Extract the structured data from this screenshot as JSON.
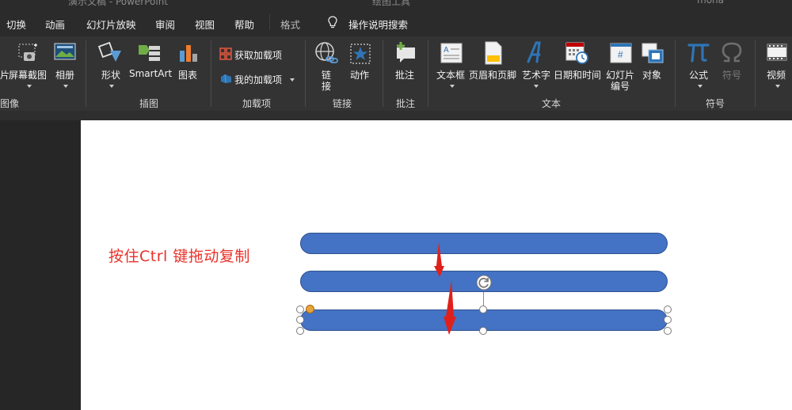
{
  "titlebar": {
    "left_text": "演示文稿 - PowerPoint",
    "center_text": "绘图工具",
    "right_text": "mona"
  },
  "tabs": [
    {
      "label": "切换"
    },
    {
      "label": "动画"
    },
    {
      "label": "幻灯片放映"
    },
    {
      "label": "审阅"
    },
    {
      "label": "视图"
    },
    {
      "label": "帮助"
    },
    {
      "label": "格式"
    },
    {
      "label": "操作说明搜索"
    }
  ],
  "ribbon": {
    "groups": {
      "images": "图像",
      "illustrations": "插图",
      "addins": "加载项",
      "links": "链接",
      "comments": "批注",
      "text": "文本",
      "symbols": "符号"
    },
    "buttons": {
      "picture_partial": "片",
      "screenshot": "屏幕截图",
      "album": "相册",
      "shapes": "形状",
      "smartart": "SmartArt",
      "chart": "图表",
      "get_addins": "获取加载项",
      "my_addins": "我的加载项",
      "link_line1": "链",
      "link_line2": "接",
      "action": "动作",
      "comment": "批注",
      "textbox": "文本框",
      "header_footer": "页眉和页脚",
      "wordart": "艺术字",
      "datetime": "日期和时间",
      "slide_number_line1": "幻灯片",
      "slide_number_line2": "编号",
      "object": "对象",
      "equation": "公式",
      "symbol": "符号",
      "video": "视频"
    }
  },
  "slide": {
    "caption": "按住Ctrl  键拖动复制"
  },
  "colors": {
    "bar_fill": "#4472c4",
    "bar_border": "#2f528f",
    "arrow_red": "#e0201b",
    "caption_red": "#e8312a",
    "ribbon_bg": "#333333",
    "tabbar_bg": "#2b2b2b"
  },
  "icons": {
    "search": "lightbulb-icon",
    "rotate": "rotate-handle-icon"
  }
}
